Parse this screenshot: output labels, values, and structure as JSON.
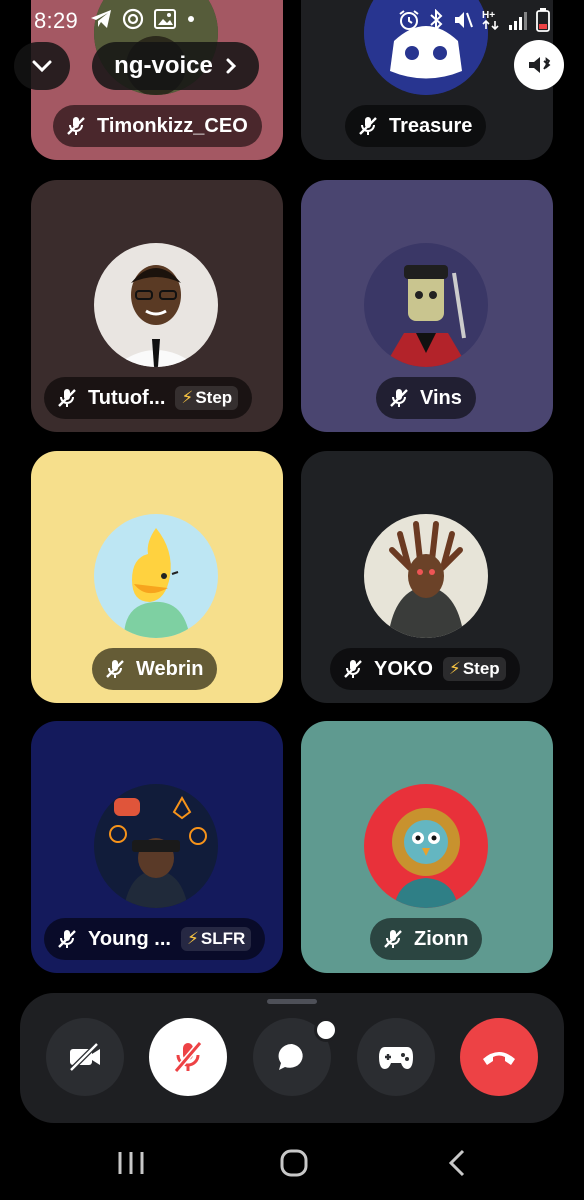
{
  "status_bar": {
    "time": "8:29",
    "left_icons": [
      "telegram-icon",
      "spiral-icon",
      "image-icon",
      "dot-icon"
    ],
    "right_icons": [
      "alarm-icon",
      "bluetooth-icon",
      "mute-icon",
      "data-icon",
      "signal-icon",
      "battery-icon"
    ]
  },
  "header": {
    "channel_name": "ng-voice",
    "collapse_icon": "chevron-down-icon",
    "arrow_icon": "chevron-right-icon",
    "audio_icon": "speaker-bluetooth-icon"
  },
  "participants": [
    {
      "name": "Timonkizz_CEO",
      "muted": true,
      "tile_color": "#a45863",
      "tag": null
    },
    {
      "name": "Treasure",
      "muted": true,
      "tile_color": "#1e1f22",
      "tag": null
    },
    {
      "name": "Tutuof...",
      "muted": true,
      "tile_color": "#3a2c2c",
      "tag": "Step"
    },
    {
      "name": "Vins",
      "muted": true,
      "tile_color": "#4a4570",
      "tag": null
    },
    {
      "name": "Webrin",
      "muted": true,
      "tile_color": "#f6df8c",
      "tag": null
    },
    {
      "name": "YOKO",
      "muted": true,
      "tile_color": "#1f2124",
      "tag": "Step"
    },
    {
      "name": "Young ...",
      "muted": true,
      "tile_color": "#141a5c",
      "tag": "SLFR"
    },
    {
      "name": "Zionn",
      "muted": true,
      "tile_color": "#5f9a90",
      "tag": null
    }
  ],
  "controls": [
    {
      "name": "camera-off-button",
      "icon": "video-off-icon",
      "color": "#2b2d31"
    },
    {
      "name": "microphone-muted-button",
      "icon": "mic-off-icon",
      "color": "#ffffff"
    },
    {
      "name": "chat-button",
      "icon": "chat-bubble-icon",
      "color": "#2b2d31"
    },
    {
      "name": "activities-button",
      "icon": "gamepad-icon",
      "color": "#2b2d31"
    },
    {
      "name": "leave-call-button",
      "icon": "phone-hangup-icon",
      "color": "#ed4245"
    }
  ],
  "nav_bar": [
    "recents-icon",
    "home-icon",
    "back-icon"
  ],
  "colors": {
    "accent_red": "#ed4245",
    "background": "#000000",
    "panel": "#1e1f22"
  }
}
